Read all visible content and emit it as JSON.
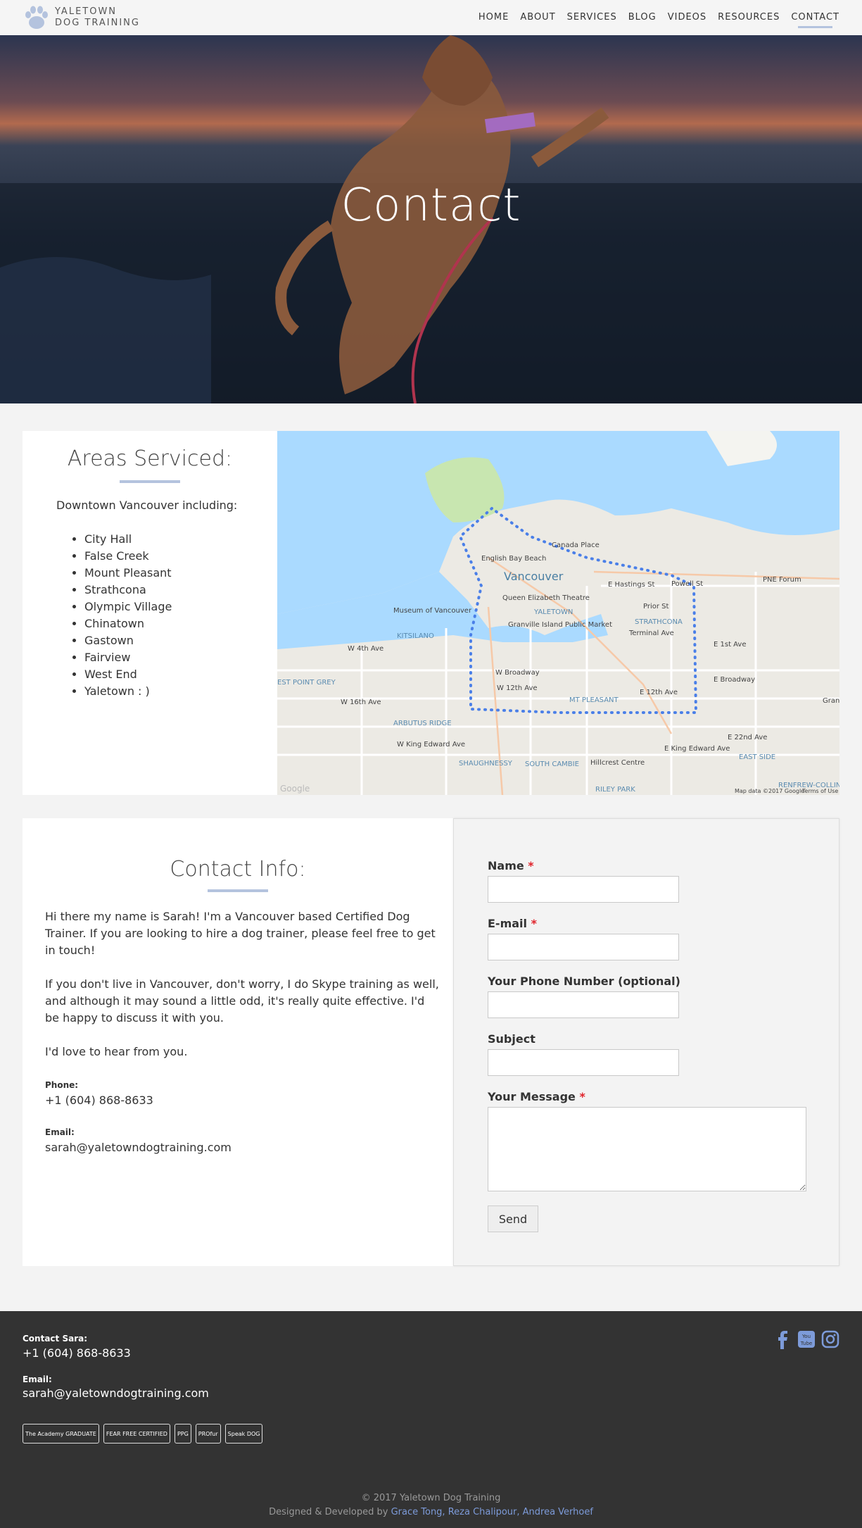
{
  "brand": {
    "line1": "YALETOWN",
    "line2": "DOG TRAINING"
  },
  "nav": [
    {
      "label": "HOME"
    },
    {
      "label": "ABOUT"
    },
    {
      "label": "SERVICES"
    },
    {
      "label": "BLOG"
    },
    {
      "label": "VIDEOS"
    },
    {
      "label": "RESOURCES"
    },
    {
      "label": "CONTACT",
      "active": true
    }
  ],
  "hero": {
    "title": "Contact"
  },
  "areas": {
    "title": "Areas Serviced:",
    "intro": "Downtown Vancouver including:",
    "list": [
      "City Hall",
      "False Creek",
      "Mount Pleasant",
      "Strathcona",
      "Olympic Village",
      "Chinatown",
      "Gastown",
      "Fairview",
      "West End",
      "Yaletown : )"
    ]
  },
  "map": {
    "labels": [
      "Vancouver",
      "Canada Place",
      "English Bay Beach",
      "Queen Elizabeth Theatre",
      "E Hastings St",
      "PNE Forum",
      "Museum of Vancouver",
      "Granville Island Public Market",
      "KITSILANO",
      "YALETOWN",
      "STRATHCONA",
      "MT PLEASANT",
      "ARBUTUS RIDGE",
      "SHAUGHNESSY",
      "SOUTH CAMBIE",
      "Hillcrest Centre",
      "RILEY PARK",
      "EAST SIDE",
      "W Broadway",
      "W 12th Ave",
      "E 12th Ave",
      "E Broadway",
      "W King Edward Ave",
      "E King Edward Ave",
      "W 16th Ave",
      "W 4th Ave",
      "EST POINT GREY",
      "E 1st Ave",
      "E 22nd Ave",
      "Powell St",
      "Terminal Ave",
      "Prior St",
      "RENFREW-COLLING",
      "Grand"
    ],
    "google": "Google",
    "attribution": "Map data ©2017 Google",
    "terms": "Terms of Use"
  },
  "contact_info": {
    "title": "Contact Info:",
    "p1": "Hi there my name is Sarah! I'm a Vancouver based Certified Dog Trainer. If you are looking to hire a dog trainer, please feel free to get in touch!",
    "p2": "If you don't live in Vancouver, don't worry, I do Skype training as well, and although it may sound a little odd, it's really quite effective. I'd be happy to discuss it with you.",
    "p3": "I'd love to hear from you.",
    "phone_label": "Phone:",
    "phone": "+1 (604) 868-8633",
    "email_label": "Email:",
    "email": "sarah@yaletowndogtraining.com"
  },
  "form": {
    "name_label": "Name",
    "email_label": "E-mail",
    "phone_label": "Your Phone Number (optional)",
    "subject_label": "Subject",
    "message_label": "Your Message",
    "required_mark": "*",
    "send": "Send"
  },
  "footer": {
    "contact_label": "Contact Sara:",
    "phone": "+1 (604) 868-8633",
    "email_label": "Email:",
    "email": "sarah@yaletowndogtraining.com",
    "badges": [
      "The Academy GRADUATE",
      "FEAR FREE CERTIFIED",
      "PPG",
      "PROfur",
      "Speak DOG"
    ],
    "copyright": "© 2017 Yaletown Dog Training",
    "credits_prefix": "Designed & Developed by",
    "credits_names": "Grace Tong, Reza Chalipour, Andrea Verhoef",
    "social": [
      "facebook-icon",
      "youtube-icon",
      "instagram-icon"
    ]
  },
  "colors": {
    "accent": "#b4c3de",
    "footer_bg": "#333333",
    "link": "#7d9bd9",
    "required": "#e0222a"
  }
}
